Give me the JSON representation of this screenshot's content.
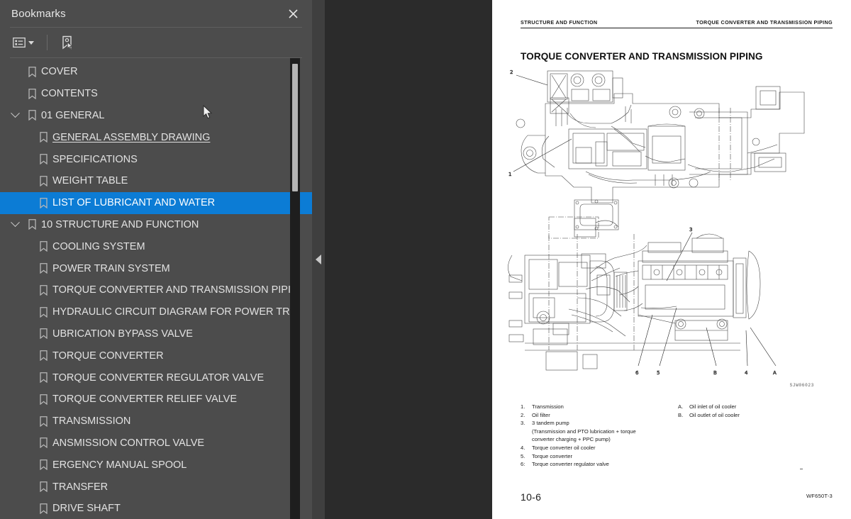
{
  "panel": {
    "title": "Bookmarks",
    "close_icon": "close-icon",
    "toolbar": {
      "options_icon": "list-options-icon",
      "options_caret": "chevron-down-icon",
      "new_bookmark_icon": "new-bookmark-icon"
    }
  },
  "bookmarks": [
    {
      "label": "COVER",
      "level": 0,
      "expandable": false,
      "selected": false,
      "underline": false
    },
    {
      "label": "CONTENTS",
      "level": 0,
      "expandable": false,
      "selected": false,
      "underline": false
    },
    {
      "label": "01 GENERAL",
      "level": 0,
      "expandable": true,
      "selected": false,
      "underline": false
    },
    {
      "label": "GENERAL ASSEMBLY DRAWING",
      "level": 1,
      "expandable": false,
      "selected": false,
      "underline": true
    },
    {
      "label": "SPECIFICATIONS",
      "level": 1,
      "expandable": false,
      "selected": false,
      "underline": false
    },
    {
      "label": "WEIGHT TABLE",
      "level": 1,
      "expandable": false,
      "selected": false,
      "underline": false
    },
    {
      "label": "LIST OF LUBRICANT AND WATER",
      "level": 1,
      "expandable": false,
      "selected": true,
      "underline": false
    },
    {
      "label": "10 STRUCTURE AND FUNCTION",
      "level": 0,
      "expandable": true,
      "selected": false,
      "underline": false
    },
    {
      "label": "COOLING SYSTEM",
      "level": 1,
      "expandable": false,
      "selected": false,
      "underline": false
    },
    {
      "label": "POWER TRAIN SYSTEM",
      "level": 1,
      "expandable": false,
      "selected": false,
      "underline": false
    },
    {
      "label": "TORQUE CONVERTER AND TRANSMISSION PIPING",
      "level": 1,
      "expandable": false,
      "selected": false,
      "underline": false
    },
    {
      "label": "HYDRAULIC CIRCUIT DIAGRAM FOR POWER TRAIN",
      "level": 1,
      "expandable": false,
      "selected": false,
      "underline": false
    },
    {
      "label": "UBRICATION BYPASS VALVE",
      "level": 1,
      "expandable": false,
      "selected": false,
      "underline": false
    },
    {
      "label": "TORQUE CONVERTER",
      "level": 1,
      "expandable": false,
      "selected": false,
      "underline": false
    },
    {
      "label": "TORQUE CONVERTER REGULATOR VALVE",
      "level": 1,
      "expandable": false,
      "selected": false,
      "underline": false
    },
    {
      "label": "TORQUE CONVERTER RELIEF VALVE",
      "level": 1,
      "expandable": false,
      "selected": false,
      "underline": false
    },
    {
      "label": "TRANSMISSION",
      "level": 1,
      "expandable": false,
      "selected": false,
      "underline": false
    },
    {
      "label": "ANSMISSION CONTROL VALVE",
      "level": 1,
      "expandable": false,
      "selected": false,
      "underline": false
    },
    {
      "label": "ERGENCY MANUAL SPOOL",
      "level": 1,
      "expandable": false,
      "selected": false,
      "underline": false
    },
    {
      "label": "TRANSFER",
      "level": 1,
      "expandable": false,
      "selected": false,
      "underline": false
    },
    {
      "label": "DRIVE SHAFT",
      "level": 1,
      "expandable": false,
      "selected": false,
      "underline": false
    }
  ],
  "divider": {
    "collapse_icon": "collapse-left-icon"
  },
  "document": {
    "header_left": "STRUCTURE AND FUNCTION",
    "header_right": "TORQUE CONVERTER AND TRANSMISSION PIPING",
    "title": "TORQUE CONVERTER AND TRANSMISSION PIPING",
    "drawing_ref": "SJW06023",
    "figure_callouts_top": [
      "2",
      "1"
    ],
    "figure_callouts_bottom": [
      "3",
      "6",
      "5",
      "B",
      "4",
      "A"
    ],
    "legend_numbered": [
      {
        "num": "1.",
        "text": "Transmission"
      },
      {
        "num": "2.",
        "text": "Oil filter"
      },
      {
        "num": "3.",
        "text": "3 tandem pump"
      },
      {
        "num": "4.",
        "text": "Torque converter oil cooler"
      },
      {
        "num": "5.",
        "text": "Torque converter"
      },
      {
        "num": "6:",
        "text": "Torque converter regulator valve"
      }
    ],
    "legend_sub_line1": "(Transmission and PTO lubrication + torque",
    "legend_sub_line2": "converter charging + PPC pump)",
    "legend_lettered": [
      {
        "num": "A.",
        "text": "Oil inlet of oil cooler"
      },
      {
        "num": "B.",
        "text": "Oil outlet of oil cooler"
      }
    ],
    "footer_left": "10-6",
    "footer_right": "WF650T-3"
  },
  "colors": {
    "panel_bg": "#4c4c4c",
    "viewer_bg": "#2b2b2b",
    "selection": "#0c7cd5",
    "text": "#e2e2e2",
    "page": "#ffffff"
  }
}
